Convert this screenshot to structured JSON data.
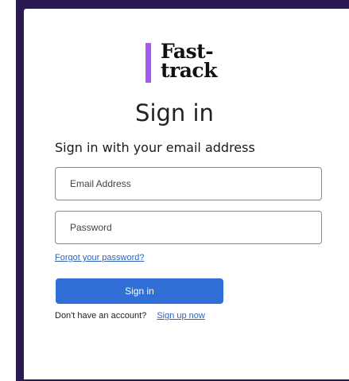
{
  "brand": {
    "logo_text": "Fast-\ntrack",
    "accent_color": "#a45af0"
  },
  "colors": {
    "backdrop": "#2b1a52",
    "teal": "#17636e",
    "button": "#2f6fd6",
    "link": "#2f63b8"
  },
  "form": {
    "title": "Sign in",
    "subtitle": "Sign in with your email address",
    "email_placeholder": "Email Address",
    "password_placeholder": "Password",
    "forgot_link": "Forgot your password?",
    "submit_label": "Sign in",
    "no_account_text": "Don't have an account?",
    "signup_link": "Sign up now"
  }
}
